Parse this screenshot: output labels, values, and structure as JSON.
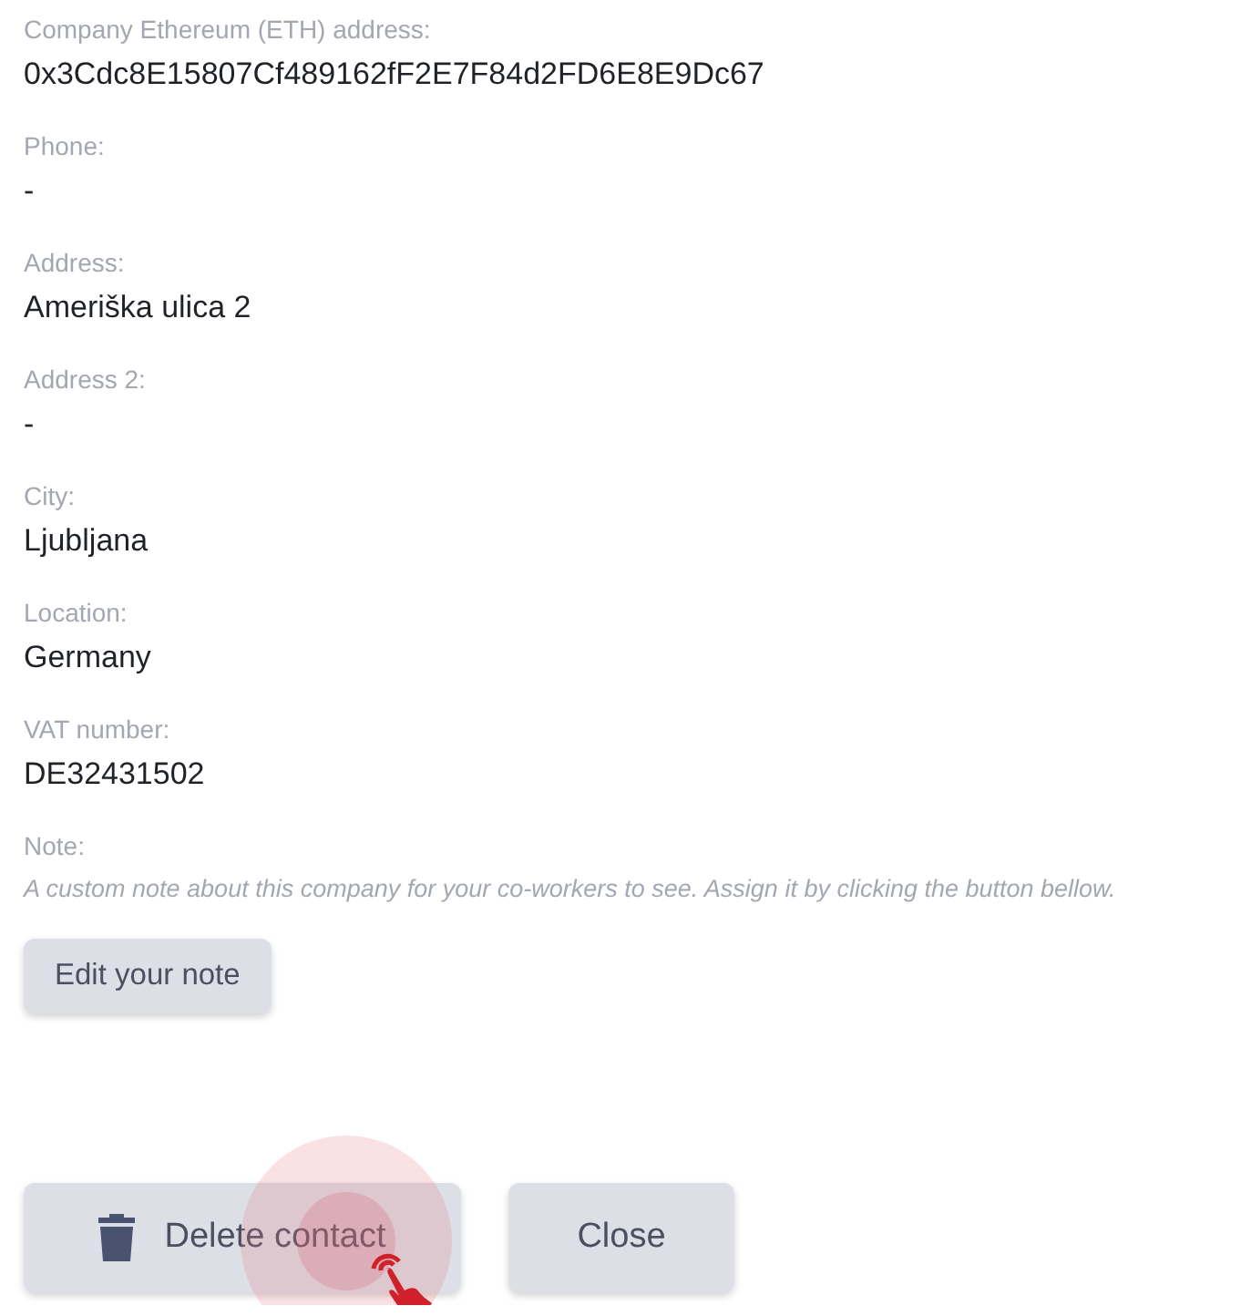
{
  "fields": [
    {
      "label": "Company Ethereum (ETH) address:",
      "value": "0x3Cdc8E15807Cf489162fF2E7F84d2FD6E8E9Dc67"
    },
    {
      "label": "Phone:",
      "value": "-"
    },
    {
      "label": "Address:",
      "value": "Ameriška ulica 2"
    },
    {
      "label": "Address 2:",
      "value": "-"
    },
    {
      "label": "City:",
      "value": "Ljubljana"
    },
    {
      "label": "Location:",
      "value": "Germany"
    },
    {
      "label": "VAT number:",
      "value": "DE32431502"
    }
  ],
  "note": {
    "label": "Note:",
    "text": "A custom note about this company for your co-workers to see. Assign it by clicking the button bellow.",
    "button": "Edit your note"
  },
  "actions": {
    "delete": "Delete contact",
    "close": "Close"
  }
}
